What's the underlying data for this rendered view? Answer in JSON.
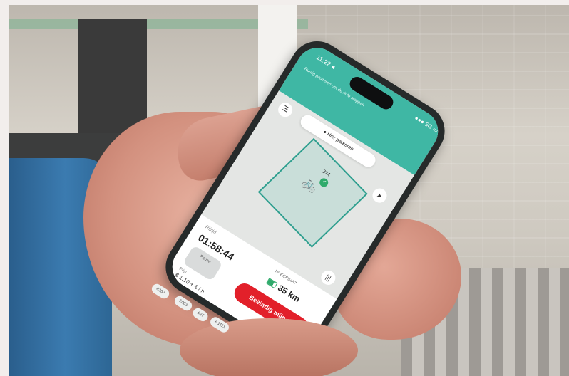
{
  "status_bar": {
    "time": "11:22 ◂",
    "battery": "●●● 5G ▭"
  },
  "top_message": "Rustig pauzeren om de rit te stoppen",
  "map": {
    "menu_icon": "☰",
    "pill_label": "● Hier parkeren",
    "locate_icon": "➤",
    "bike_label": "374",
    "bike_badge": "✓",
    "filter_icon": "|||"
  },
  "trip": {
    "label": "Rijtijd",
    "timer": "01:58:44",
    "pause_label": "Pauze",
    "price_label": "Prijs",
    "price": "€ 1,10 + € / h",
    "bike_id": "Nº ECR8467",
    "range": "35 km",
    "end_button": "Beëindig mijn rit"
  },
  "chips": [
    "#367",
    "1083",
    "#37",
    "+ 1111"
  ],
  "colors": {
    "accent": "#3fb7a4",
    "end_button": "#e2202a",
    "battery": "#2faa6b"
  }
}
